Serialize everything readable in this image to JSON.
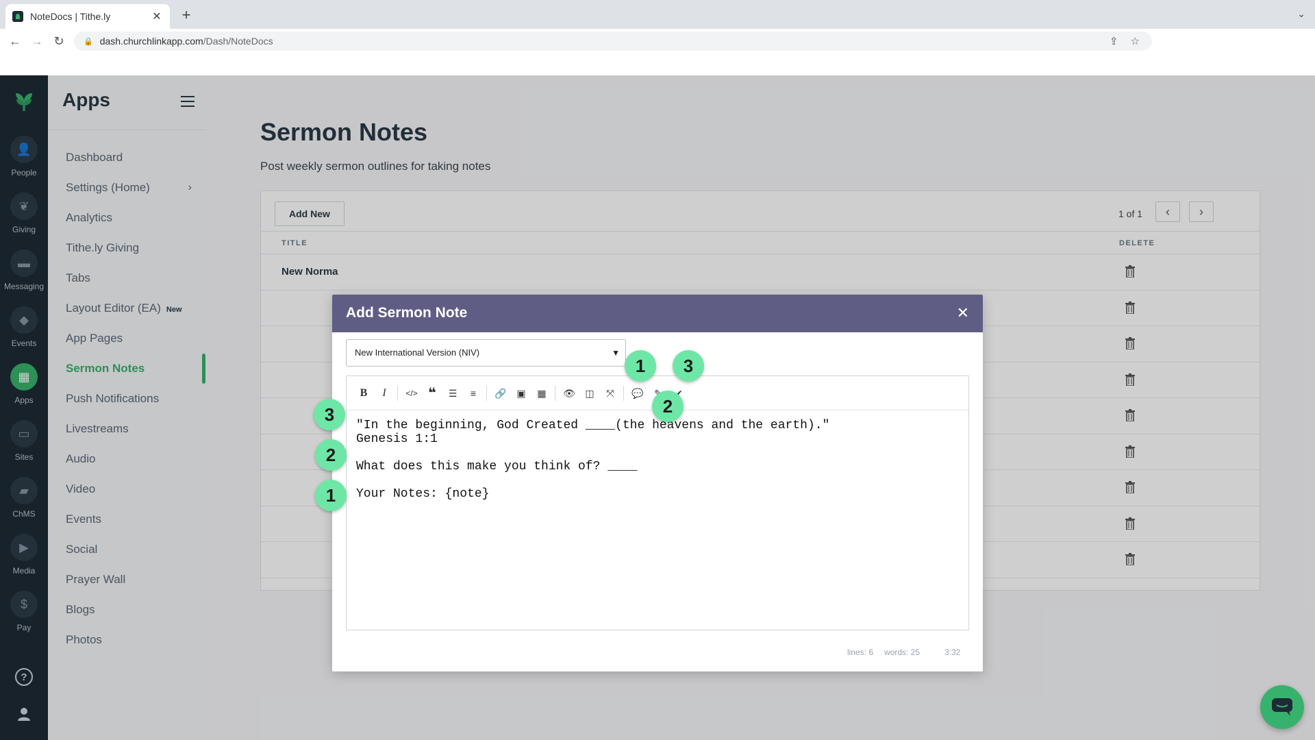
{
  "browser": {
    "tab_title": "NoteDocs | Tithe.ly",
    "url_host": "dash.churchlinkapp.com",
    "url_path": "/Dash/NoteDocs"
  },
  "rail": {
    "items": [
      {
        "label": "People",
        "icon": "people-icon"
      },
      {
        "label": "Giving",
        "icon": "giving-icon"
      },
      {
        "label": "Messaging",
        "icon": "messaging-icon"
      },
      {
        "label": "Events",
        "icon": "events-icon"
      },
      {
        "label": "Apps",
        "icon": "apps-icon"
      },
      {
        "label": "Sites",
        "icon": "sites-icon"
      },
      {
        "label": "ChMS",
        "icon": "chms-icon"
      },
      {
        "label": "Media",
        "icon": "media-icon"
      },
      {
        "label": "Pay",
        "icon": "pay-icon"
      }
    ],
    "active": "Apps"
  },
  "sidebar": {
    "title": "Apps",
    "items": [
      {
        "label": "Dashboard"
      },
      {
        "label": "Settings (Home)"
      },
      {
        "label": "Analytics"
      },
      {
        "label": "Tithe.ly Giving"
      },
      {
        "label": "Tabs"
      },
      {
        "label": "Layout Editor (EA)",
        "badge": "New"
      },
      {
        "label": "App Pages"
      },
      {
        "label": "Sermon Notes"
      },
      {
        "label": "Push Notifications"
      },
      {
        "label": "Livestreams"
      },
      {
        "label": "Audio"
      },
      {
        "label": "Video"
      },
      {
        "label": "Events"
      },
      {
        "label": "Social"
      },
      {
        "label": "Prayer Wall"
      },
      {
        "label": "Blogs"
      },
      {
        "label": "Photos"
      }
    ]
  },
  "main": {
    "title": "Sermon Notes",
    "subtitle": "Post weekly sermon outlines for taking notes",
    "add_button": "Add New",
    "pager_text": "1 of 1",
    "col_title": "TITLE",
    "col_delete": "DELETE",
    "first_row_title": "New Norma"
  },
  "modal": {
    "title": "Add Sermon Note",
    "version_select": "New International Version (NIV)",
    "editor_lines": [
      "\"In the beginning, God Created ____(the heavens and the earth).\"",
      "Genesis 1:1",
      "",
      "What does this make you think of? ____",
      "",
      "Your Notes: {note}"
    ],
    "status_lines": "lines: 6",
    "status_words": "words: 25",
    "status_cursor": "3:32"
  },
  "markers": {
    "toolbar_left": "1",
    "toolbar_right": "3",
    "toolbar_mid": "2",
    "line_scripture": "3",
    "line_question": "2",
    "line_notes": "1"
  },
  "colors": {
    "accent": "#37b26c",
    "modal_header": "#5f5d83",
    "rail": "#1d2b36",
    "marker": "#6ee7a6"
  }
}
